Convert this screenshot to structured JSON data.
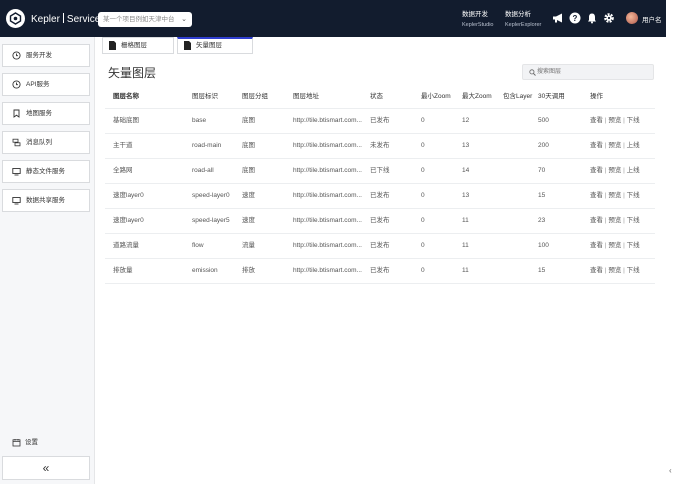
{
  "header": {
    "brand_left": "Kepler",
    "brand_right": "Service",
    "project_placeholder": "某一个项目例如天津中台",
    "links": [
      {
        "label": "数据开发",
        "sub": "KeplerStudio"
      },
      {
        "label": "数据分析",
        "sub": "KeplerExplorer"
      }
    ],
    "username": "用户名"
  },
  "sidebar": {
    "items": [
      {
        "label": "服务开发",
        "icon": "clock-icon"
      },
      {
        "label": "API服务",
        "icon": "clock-icon"
      },
      {
        "label": "地图服务",
        "icon": "bookmark-icon"
      },
      {
        "label": "消息队列",
        "icon": "queue-icon"
      },
      {
        "label": "静态文件服务",
        "icon": "monitor-icon"
      },
      {
        "label": "数据共享服务",
        "icon": "monitor-icon"
      }
    ],
    "settings_label": "设置",
    "collapse_label": "«"
  },
  "tabs": [
    {
      "label": "栅格图层",
      "active": false
    },
    {
      "label": "矢量图层",
      "active": true
    }
  ],
  "main": {
    "title": "矢量图层",
    "search_placeholder": "搜索图层"
  },
  "table": {
    "columns": [
      "图层名称",
      "图层标识",
      "图层分组",
      "图层地址",
      "状态",
      "最小Zoom",
      "最大Zoom",
      "包含Layer",
      "30天调用",
      "操作"
    ],
    "rows": [
      {
        "name": "基础底图",
        "id": "base",
        "group": "底图",
        "url": "http://tile.btismart.com...",
        "status": "已发布",
        "min": "0",
        "max": "12",
        "layer": "",
        "calls": "500",
        "ops": [
          "查看",
          "预览",
          "下线"
        ]
      },
      {
        "name": "主干道",
        "id": "road-main",
        "group": "底图",
        "url": "http://tile.btismart.com...",
        "status": "未发布",
        "min": "0",
        "max": "13",
        "layer": "",
        "calls": "200",
        "ops": [
          "查看",
          "预览",
          "上线"
        ]
      },
      {
        "name": "全路网",
        "id": "road-all",
        "group": "底图",
        "url": "http://tile.btismart.com...",
        "status": "已下线",
        "min": "0",
        "max": "14",
        "layer": "",
        "calls": "70",
        "ops": [
          "查看",
          "预览",
          "上线"
        ]
      },
      {
        "name": "速度layer0",
        "id": "speed-layer0",
        "group": "速度",
        "url": "http://tile.btismart.com...",
        "status": "已发布",
        "min": "0",
        "max": "13",
        "layer": "",
        "calls": "15",
        "ops": [
          "查看",
          "预览",
          "下线"
        ]
      },
      {
        "name": "速度layer0",
        "id": "speed-layer5",
        "group": "速度",
        "url": "http://tile.btismart.com...",
        "status": "已发布",
        "min": "0",
        "max": "11",
        "layer": "",
        "calls": "23",
        "ops": [
          "查看",
          "预览",
          "下线"
        ]
      },
      {
        "name": "道路流量",
        "id": "flow",
        "group": "流量",
        "url": "http://tile.btismart.com...",
        "status": "已发布",
        "min": "0",
        "max": "11",
        "layer": "",
        "calls": "100",
        "ops": [
          "查看",
          "预览",
          "下线"
        ]
      },
      {
        "name": "排放量",
        "id": "emission",
        "group": "排放",
        "url": "http://tile.btismart.com...",
        "status": "已发布",
        "min": "0",
        "max": "11",
        "layer": "",
        "calls": "15",
        "ops": [
          "查看",
          "预览",
          "下线"
        ]
      }
    ]
  },
  "colors": {
    "topbar": "#121c2e",
    "accent": "#2f3ecf"
  }
}
